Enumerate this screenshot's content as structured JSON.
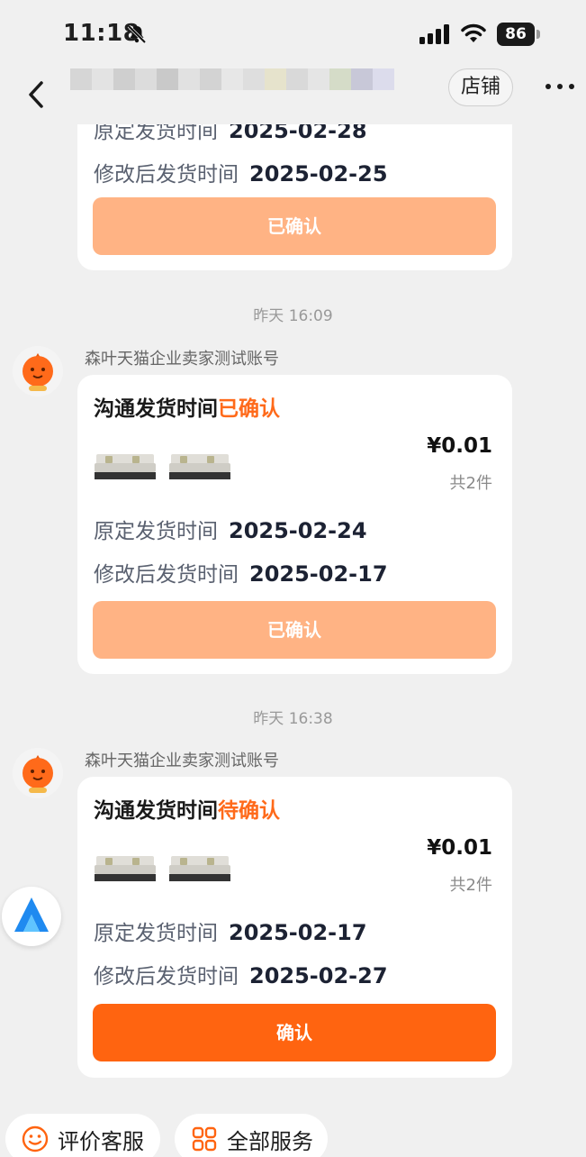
{
  "status_bar": {
    "time": "11:18",
    "battery": "86"
  },
  "nav": {
    "shop_label": "店铺"
  },
  "messages": [
    {
      "partial": true,
      "original_label": "原定发货时间",
      "original_date": "2025-02-28",
      "modified_label": "修改后发货时间",
      "modified_date": "2025-02-25",
      "button_label": "已确认"
    },
    {
      "timestamp": "昨天 16:09",
      "sender": "森叶天猫企业卖家测试账号",
      "title": "沟通发货时间",
      "status": "已确认",
      "price": "¥0.01",
      "quantity": "共2件",
      "original_label": "原定发货时间",
      "original_date": "2025-02-24",
      "modified_label": "修改后发货时间",
      "modified_date": "2025-02-17",
      "button_label": "已确认"
    },
    {
      "timestamp": "昨天 16:38",
      "sender": "森叶天猫企业卖家测试账号",
      "title": "沟通发货时间",
      "status": "待确认",
      "price": "¥0.01",
      "quantity": "共2件",
      "original_label": "原定发货时间",
      "original_date": "2025-02-17",
      "modified_label": "修改后发货时间",
      "modified_date": "2025-02-27",
      "button_label": "确认"
    }
  ],
  "quick_actions": [
    {
      "label": "评价客服",
      "icon": "smile-icon"
    },
    {
      "label": "全部服务",
      "icon": "grid-icon"
    }
  ],
  "colors": {
    "accent": "#ff6410",
    "accent_disabled": "#ffb384",
    "status_text": "#ff6a1a",
    "background": "#f0f0f0"
  }
}
